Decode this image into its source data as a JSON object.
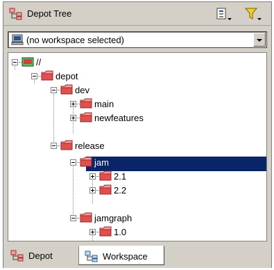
{
  "header": {
    "title": "Depot Tree",
    "icons": [
      "depot-tree-icon",
      "view-options-icon",
      "filter-icon"
    ]
  },
  "workspace": {
    "selected": "(no workspace selected)",
    "icon": "workspace-computer-icon"
  },
  "tree": {
    "root": "//",
    "depot": "depot",
    "dev": "dev",
    "main": "main",
    "newfeatures": "newfeatures",
    "release": "release",
    "jam": "jam",
    "jam_21": "2.1",
    "jam_22": "2.2",
    "jamgraph": "jamgraph",
    "jamgraph_10": "1.0",
    "selected": "jam"
  },
  "tabs": [
    {
      "label": "Depot",
      "icon": "depot-tab-icon",
      "active": false
    },
    {
      "label": "Workspace",
      "icon": "workspace-tab-icon",
      "active": true
    }
  ],
  "colors": {
    "selection": "#0a246a",
    "folder": "#e05050",
    "chrome": "#d4d0c8"
  }
}
